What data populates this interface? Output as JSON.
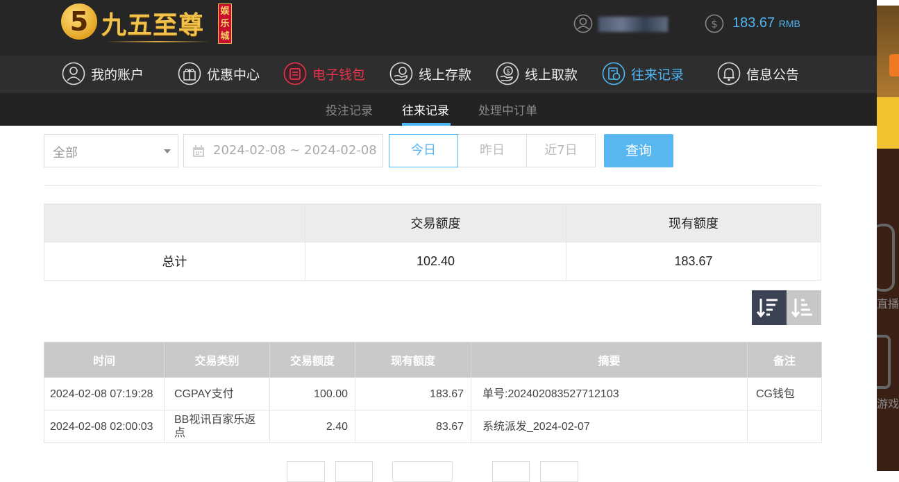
{
  "brand": {
    "logo_mark": "5",
    "logo_text": "九五至尊",
    "logo_tag": "娱乐城"
  },
  "account": {
    "balance": "183.67",
    "currency": "RMB"
  },
  "nav": [
    {
      "label": "我的账户",
      "icon": "user-icon"
    },
    {
      "label": "优惠中心",
      "icon": "gift-icon"
    },
    {
      "label": "电子钱包",
      "icon": "wallet-icon"
    },
    {
      "label": "线上存款",
      "icon": "deposit-icon"
    },
    {
      "label": "线上取款",
      "icon": "withdraw-icon"
    },
    {
      "label": "往来记录",
      "icon": "records-icon"
    },
    {
      "label": "信息公告",
      "icon": "bell-icon"
    }
  ],
  "subnav": [
    "投注记录",
    "往来记录",
    "处理中订单"
  ],
  "filters": {
    "type_value": "全部",
    "date_range": "2024-02-08 ~ 2024-02-08",
    "quick": [
      "今日",
      "昨日",
      "近7日"
    ],
    "query_label": "查询"
  },
  "summary": {
    "headers": [
      "",
      "交易额度",
      "现有额度"
    ],
    "row_label": "总计",
    "trade_amount": "102.40",
    "current_amount": "183.67"
  },
  "records": {
    "headers": [
      "时间",
      "交易类别",
      "交易额度",
      "现有额度",
      "摘要",
      "备注"
    ],
    "rows": [
      [
        "2024-02-08 07:19:28",
        "CGPAY支付",
        "100.00",
        "183.67",
        "单号:202402083527712103",
        "CG钱包"
      ],
      [
        "2024-02-08 02:00:03",
        "BB视讯百家乐返点",
        "2.40",
        "83.67",
        "系统派发_2024-02-07",
        ""
      ]
    ]
  },
  "side_panel": {
    "label_1": "直播",
    "label_2": "游戏"
  },
  "colors": {
    "accent": "#4fb7f3",
    "highlight_red": "#e8334a",
    "header_bg": "#262626"
  }
}
